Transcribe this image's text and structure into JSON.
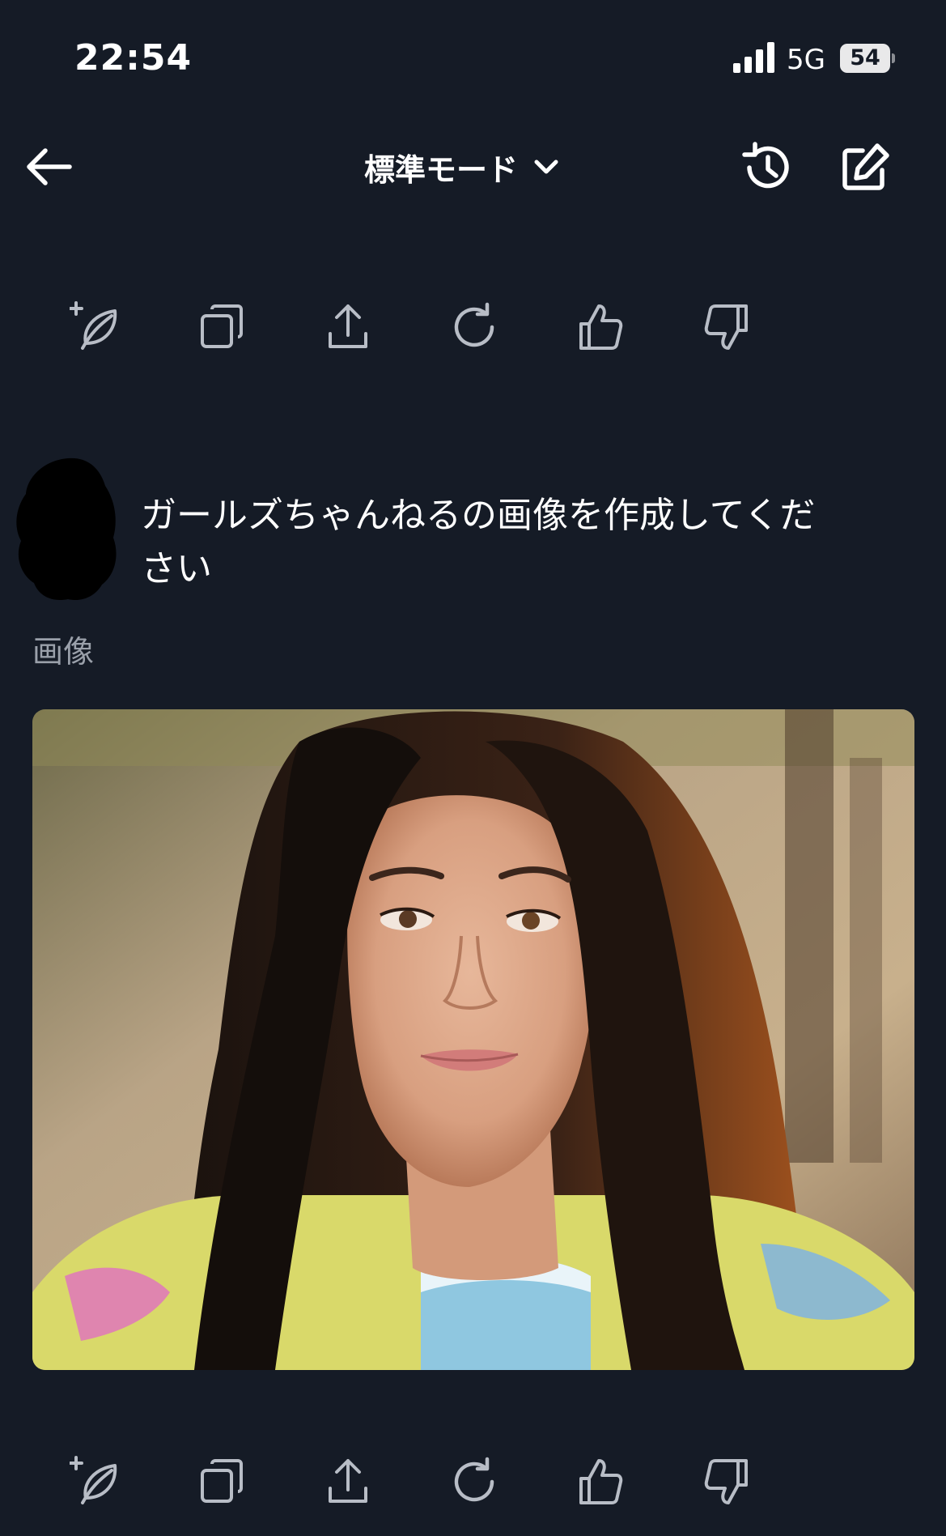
{
  "status_bar": {
    "time": "22:54",
    "network": "5G",
    "battery": "54"
  },
  "header": {
    "mode_label": "標準モード",
    "back_icon": "arrow-left-icon",
    "dropdown_icon": "chevron-down-icon",
    "history_icon": "history-icon",
    "compose_icon": "new-chat-icon"
  },
  "message_actions": [
    "sparkle-leaf-icon",
    "copy-icon",
    "share-icon",
    "regenerate-icon",
    "thumbs-up-icon",
    "thumbs-down-icon"
  ],
  "user_message": {
    "text": "ガールズちゃんねるの画像を作成してください"
  },
  "response": {
    "label": "画像",
    "image_icon": "generated-portrait-image"
  },
  "colors": {
    "background": "#151b26",
    "icon": "#b8bdc6",
    "text": "#ffffff",
    "muted": "#9aa0aa"
  }
}
